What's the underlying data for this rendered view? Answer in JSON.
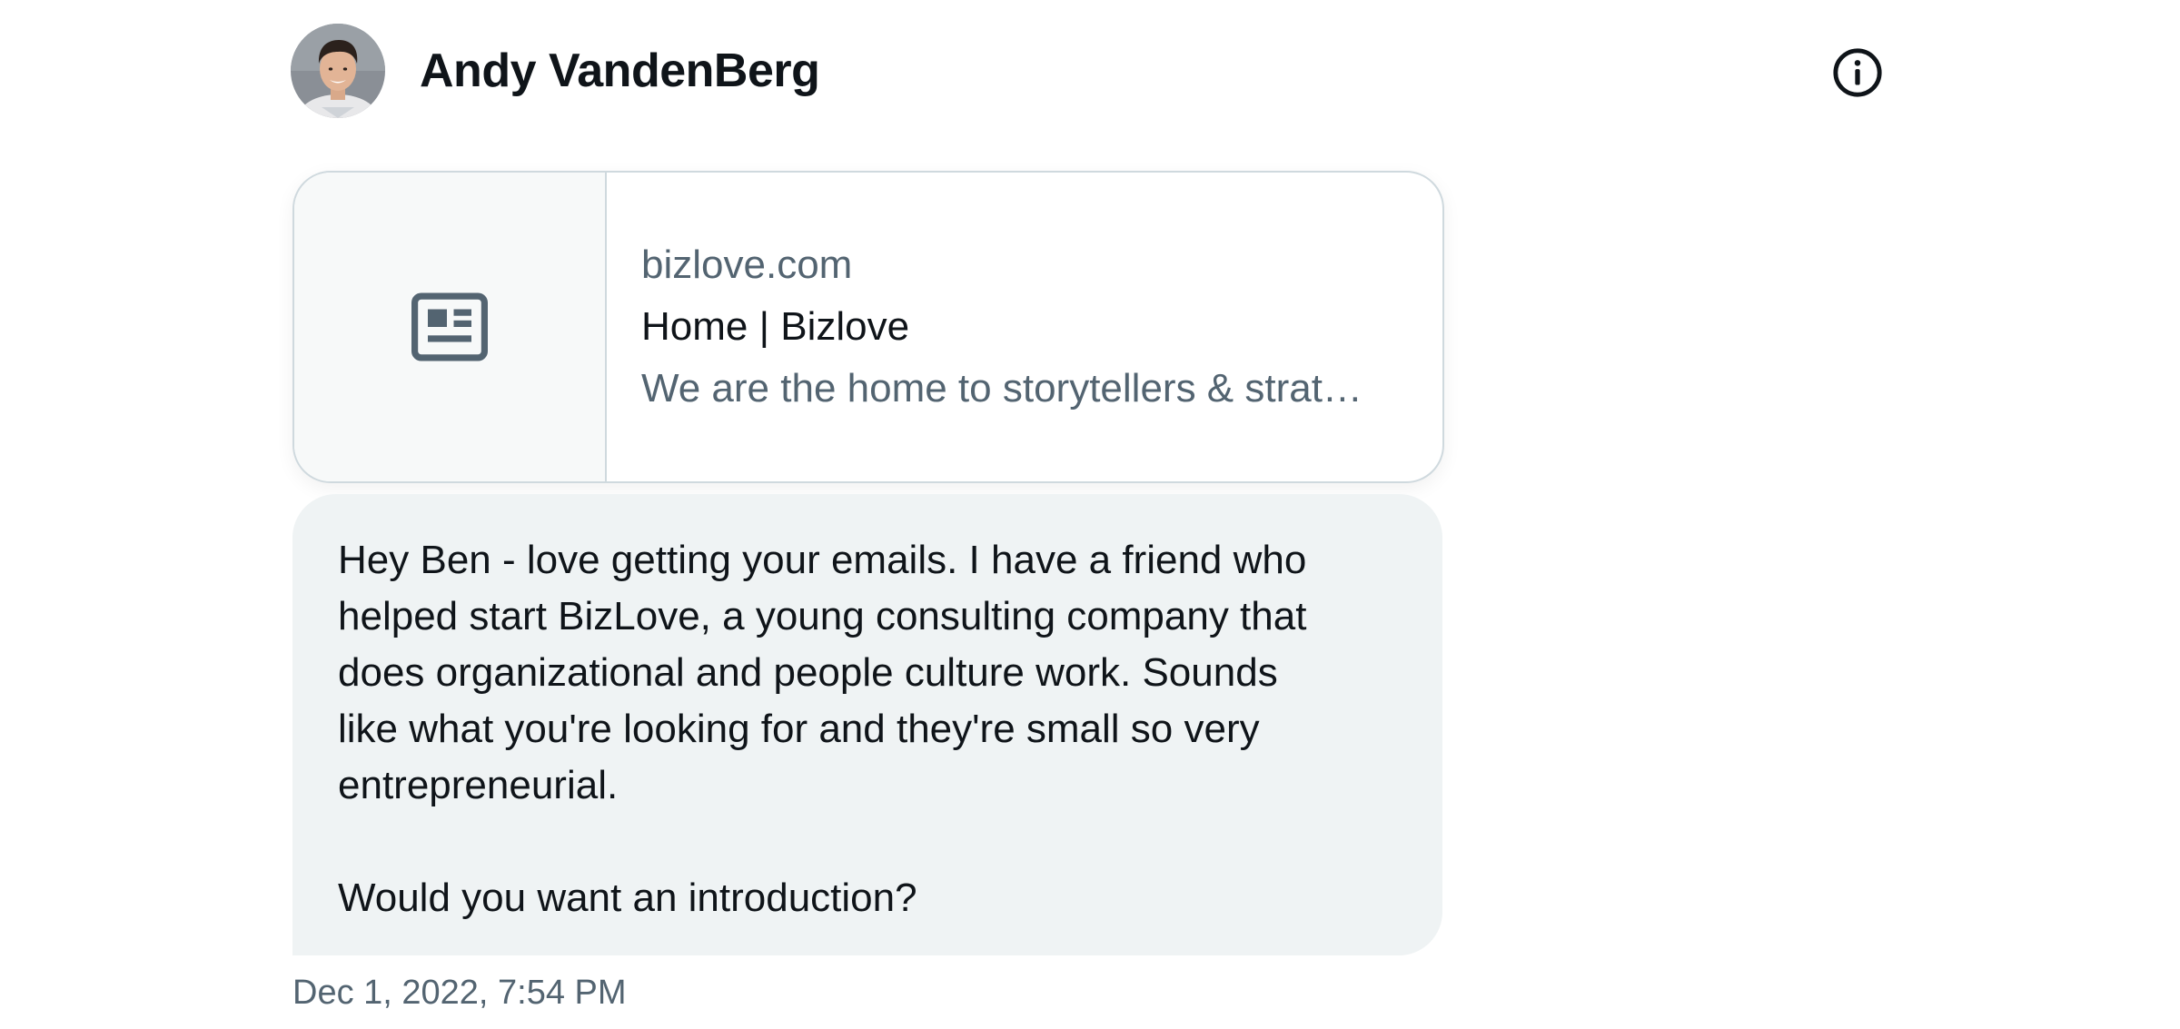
{
  "conversation": {
    "user_name": "Andy VandenBerg",
    "avatar": "user-avatar",
    "info_icon": "info-icon"
  },
  "link_card": {
    "thumbnail_icon": "article-icon",
    "domain": "bizlove.com",
    "title": "Home | Bizlove",
    "description": "We are the home to storytellers & strat…"
  },
  "message": {
    "text": "Hey Ben - love getting your emails. I have a friend who\nhelped start BizLove, a young consulting company that\ndoes organizational and people culture work. Sounds\nlike what you're looking for and they're small so very\nentrepreneurial.\n\nWould you want an introduction?",
    "timestamp": "Dec 1, 2022, 7:54 PM"
  },
  "colors": {
    "text_primary": "#0f1419",
    "text_secondary": "#536471",
    "bubble_bg": "#eff3f4",
    "card_border": "#cfd9de"
  }
}
